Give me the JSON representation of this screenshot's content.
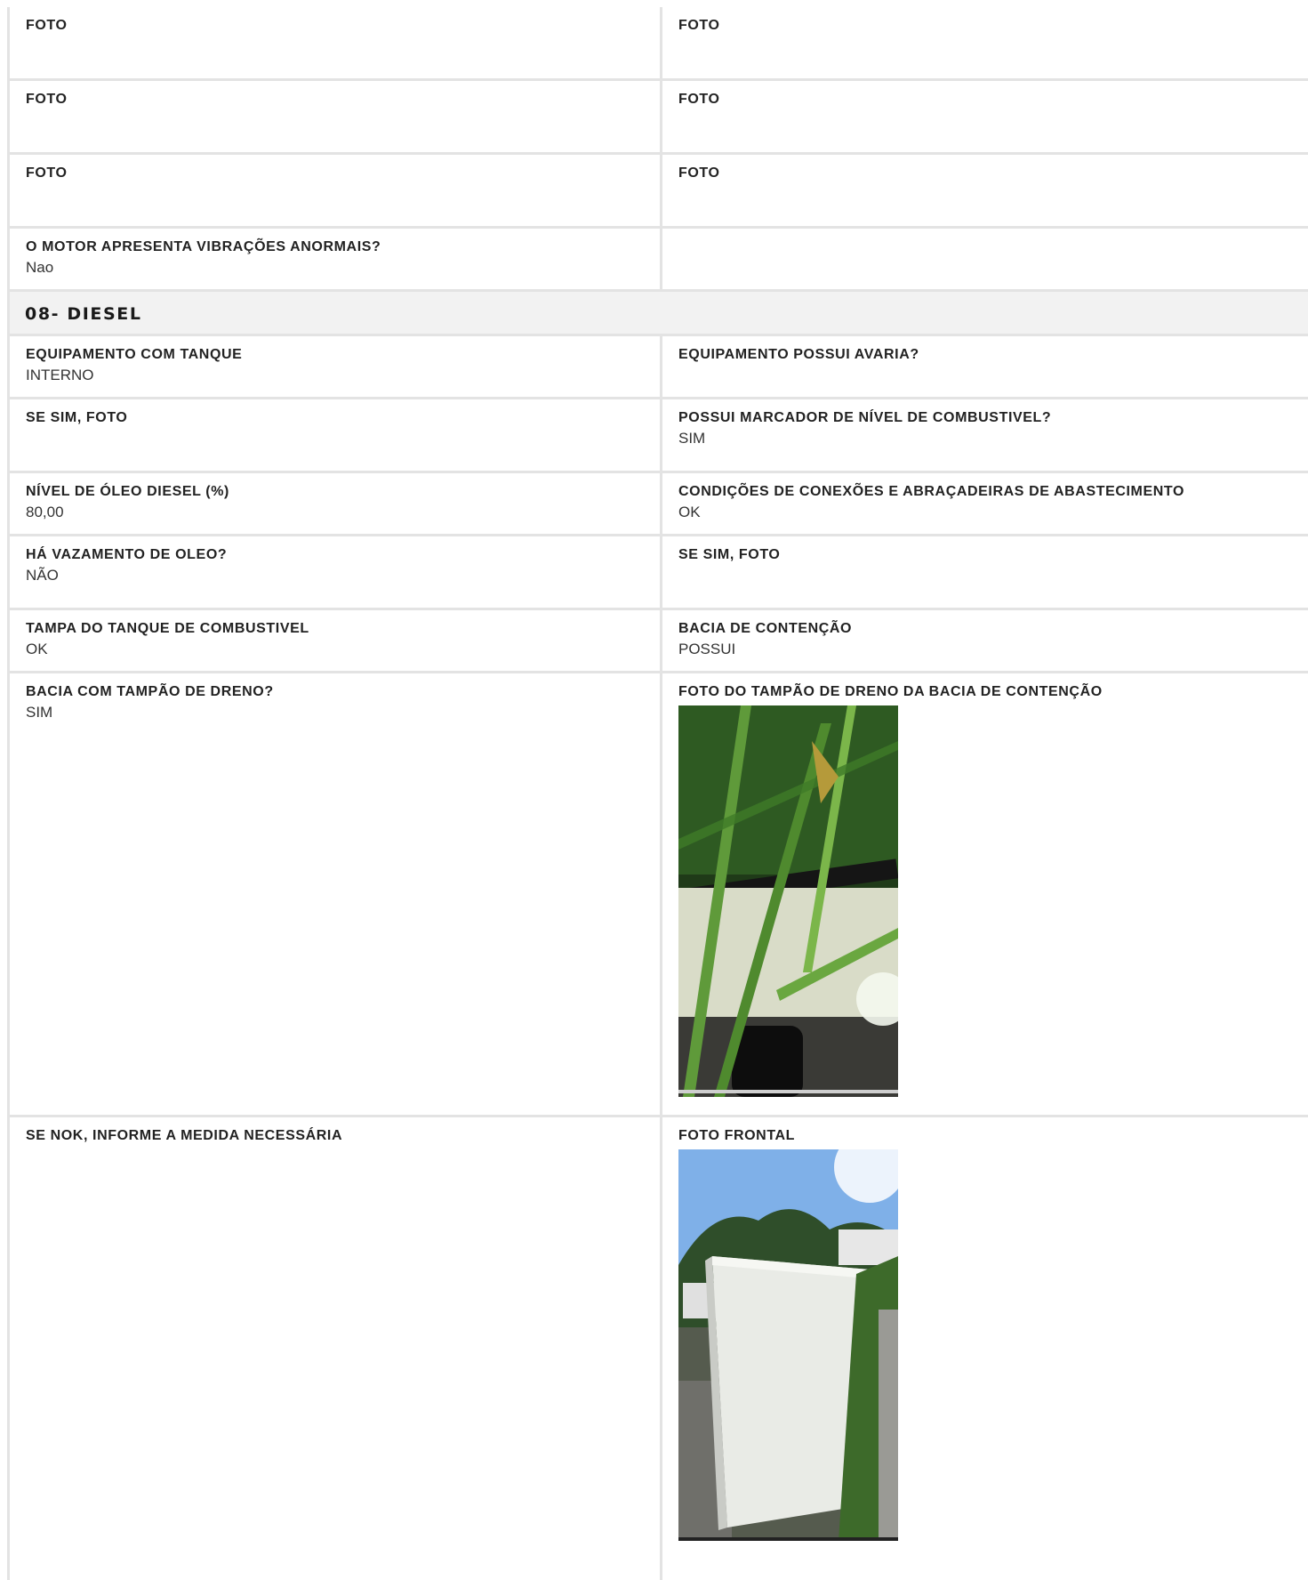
{
  "top_rows": [
    {
      "left": {
        "label": "FOTO",
        "value": ""
      },
      "right": {
        "label": "FOTO",
        "value": ""
      }
    },
    {
      "left": {
        "label": "FOTO",
        "value": ""
      },
      "right": {
        "label": "FOTO",
        "value": ""
      }
    },
    {
      "left": {
        "label": "FOTO",
        "value": ""
      },
      "right": {
        "label": "FOTO",
        "value": ""
      }
    },
    {
      "left": {
        "label": "O MOTOR APRESENTA VIBRAÇÕES ANORMAIS?",
        "value": "Nao"
      },
      "right": {
        "label": "",
        "value": ""
      }
    }
  ],
  "section": {
    "title": "08- DIESEL"
  },
  "diesel_rows": [
    {
      "left": {
        "label": "EQUIPAMENTO COM TANQUE",
        "value": "INTERNO"
      },
      "right": {
        "label": "EQUIPAMENTO POSSUI AVARIA?",
        "value": ""
      }
    },
    {
      "left": {
        "label": "SE SIM, FOTO",
        "value": ""
      },
      "right": {
        "label": "POSSUI MARCADOR DE NÍVEL DE COMBUSTIVEL?",
        "value": "SIM"
      }
    },
    {
      "left": {
        "label": "NÍVEL DE ÓLEO DIESEL (%)",
        "value": "80,00"
      },
      "right": {
        "label": "CONDIÇÕES DE CONEXÕES E ABRAÇADEIRAS DE ABASTECIMENTO",
        "value": "OK"
      }
    },
    {
      "left": {
        "label": "HÁ VAZAMENTO DE OLEO?",
        "value": "NÃO"
      },
      "right": {
        "label": "SE SIM, FOTO",
        "value": ""
      }
    },
    {
      "left": {
        "label": "TAMPA DO TANQUE DE COMBUSTIVEL",
        "value": "OK"
      },
      "right": {
        "label": "BACIA DE CONTENÇÃO",
        "value": "POSSUI"
      }
    },
    {
      "left": {
        "label": "BACIA COM TAMPÃO DE DRENO?",
        "value": "SIM"
      },
      "right": {
        "label": "FOTO DO TAMPÃO DE DRENO DA BACIA DE CONTENÇÃO",
        "value": ""
      }
    },
    {
      "left": {
        "label": "SE NOK, INFORME A MEDIDA NECESSÁRIA",
        "value": ""
      },
      "right": {
        "label": "FOTO FRONTAL",
        "value": ""
      }
    }
  ],
  "colors": {
    "border": "#e3e3e3",
    "section_bg": "#f2f2f2"
  }
}
